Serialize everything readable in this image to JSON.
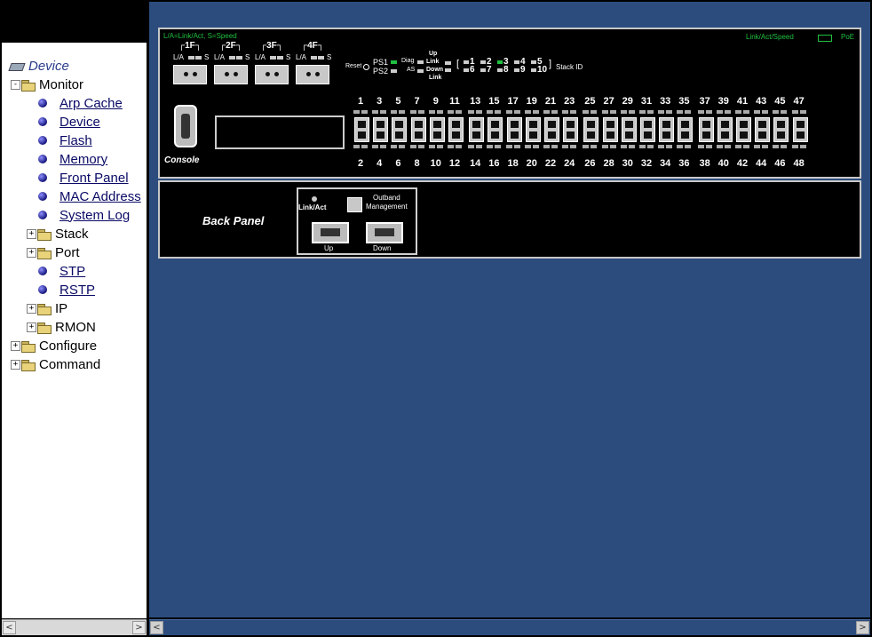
{
  "tree": {
    "root": {
      "label": "Device",
      "icon": "device-icon"
    },
    "monitor": {
      "label": "Monitor",
      "expander": "-",
      "items": [
        {
          "label": "Arp Cache"
        },
        {
          "label": "Device"
        },
        {
          "label": "Flash"
        },
        {
          "label": "Memory"
        },
        {
          "label": "Front Panel"
        },
        {
          "label": "MAC Address"
        },
        {
          "label": "System Log"
        }
      ],
      "folders": [
        {
          "label": "Stack",
          "expander": "+"
        },
        {
          "label": "Port",
          "expander": "+"
        }
      ],
      "links2": [
        {
          "label": "STP"
        },
        {
          "label": "RSTP"
        }
      ],
      "folders2": [
        {
          "label": "IP",
          "expander": "+"
        },
        {
          "label": "RMON",
          "expander": "+"
        }
      ]
    },
    "top_folders": [
      {
        "label": "Configure",
        "expander": "+"
      },
      {
        "label": "Command",
        "expander": "+"
      }
    ]
  },
  "scroll": {
    "left_arrow": "<",
    "right_arrow": ">"
  },
  "front_panel": {
    "legend_left": "L/A=Link/Act, S=Speed",
    "legend_right": "Link/Act/Speed",
    "legend_poe": "PoE",
    "reset_label": "Reset",
    "ps1": "PS1",
    "ps2": "PS2",
    "diag": "Diag",
    "as": "AS",
    "up_link": "Up Link",
    "down_link": "Down Link",
    "up_word": "Up",
    "link_word": "Link",
    "down_word": "Down",
    "stack_id_label": "Stack ID",
    "stack_ids_top": [
      "1",
      "2",
      "3",
      "4",
      "5"
    ],
    "stack_ids_bottom": [
      "6",
      "7",
      "8",
      "9",
      "10"
    ],
    "console_label": "Console",
    "fiber_ports": [
      {
        "title": "1F",
        "la": "L/A",
        "s": "S"
      },
      {
        "title": "2F",
        "la": "L/A",
        "s": "S"
      },
      {
        "title": "3F",
        "la": "L/A",
        "s": "S"
      },
      {
        "title": "4F",
        "la": "L/A",
        "s": "S"
      }
    ],
    "port_numbers_top": [
      "1",
      "3",
      "5",
      "7",
      "9",
      "11",
      "13",
      "15",
      "17",
      "19",
      "21",
      "23",
      "25",
      "27",
      "29",
      "31",
      "33",
      "35",
      "37",
      "39",
      "41",
      "43",
      "45",
      "47"
    ],
    "port_numbers_bottom": [
      "2",
      "4",
      "6",
      "8",
      "10",
      "12",
      "14",
      "16",
      "18",
      "20",
      "22",
      "24",
      "26",
      "28",
      "30",
      "32",
      "34",
      "36",
      "38",
      "40",
      "42",
      "44",
      "46",
      "48"
    ]
  },
  "back_panel": {
    "title": "Back Panel",
    "link_act": "Link/Act",
    "outband": "Outband",
    "management": "Management",
    "up": "Up",
    "down": "Down"
  },
  "colors": {
    "content_bg": "#2c4c7e",
    "led_green": "#20c040",
    "panel_bg": "#000000"
  }
}
